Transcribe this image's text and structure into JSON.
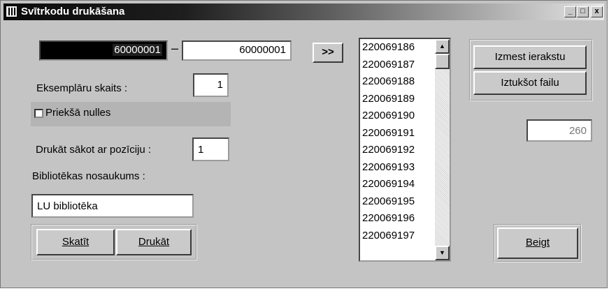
{
  "window": {
    "title": "Svītrkodu drukāšana",
    "controls": {
      "minimize": "_",
      "maximize": "□",
      "close": "x"
    }
  },
  "range": {
    "from": "60000001",
    "separator": "–",
    "to": "60000001",
    "go_label": ">>"
  },
  "copies": {
    "label": "Eksemplāru skaits :",
    "value": "1"
  },
  "leading_zeros": {
    "label": "Priekšā nulles",
    "checked": false
  },
  "start_position": {
    "label": "Drukāt sākot ar pozīciju :",
    "value": "1"
  },
  "library": {
    "label": "Bibliotēkas nosaukums :",
    "value": "LU bibliotēka"
  },
  "actions": {
    "view_label": "Skatīt",
    "print_label": "Drukāt"
  },
  "barcode_list": {
    "items": [
      "220069186",
      "220069187",
      "220069188",
      "220069189",
      "220069190",
      "220069191",
      "220069192",
      "220069193",
      "220069194",
      "220069195",
      "220069196",
      "220069197"
    ]
  },
  "side_buttons": {
    "remove_label": "Izmest ierakstu",
    "clear_label": "Iztukšot failu"
  },
  "count": {
    "value": "260"
  },
  "close_button": {
    "label": "Beigt"
  }
}
